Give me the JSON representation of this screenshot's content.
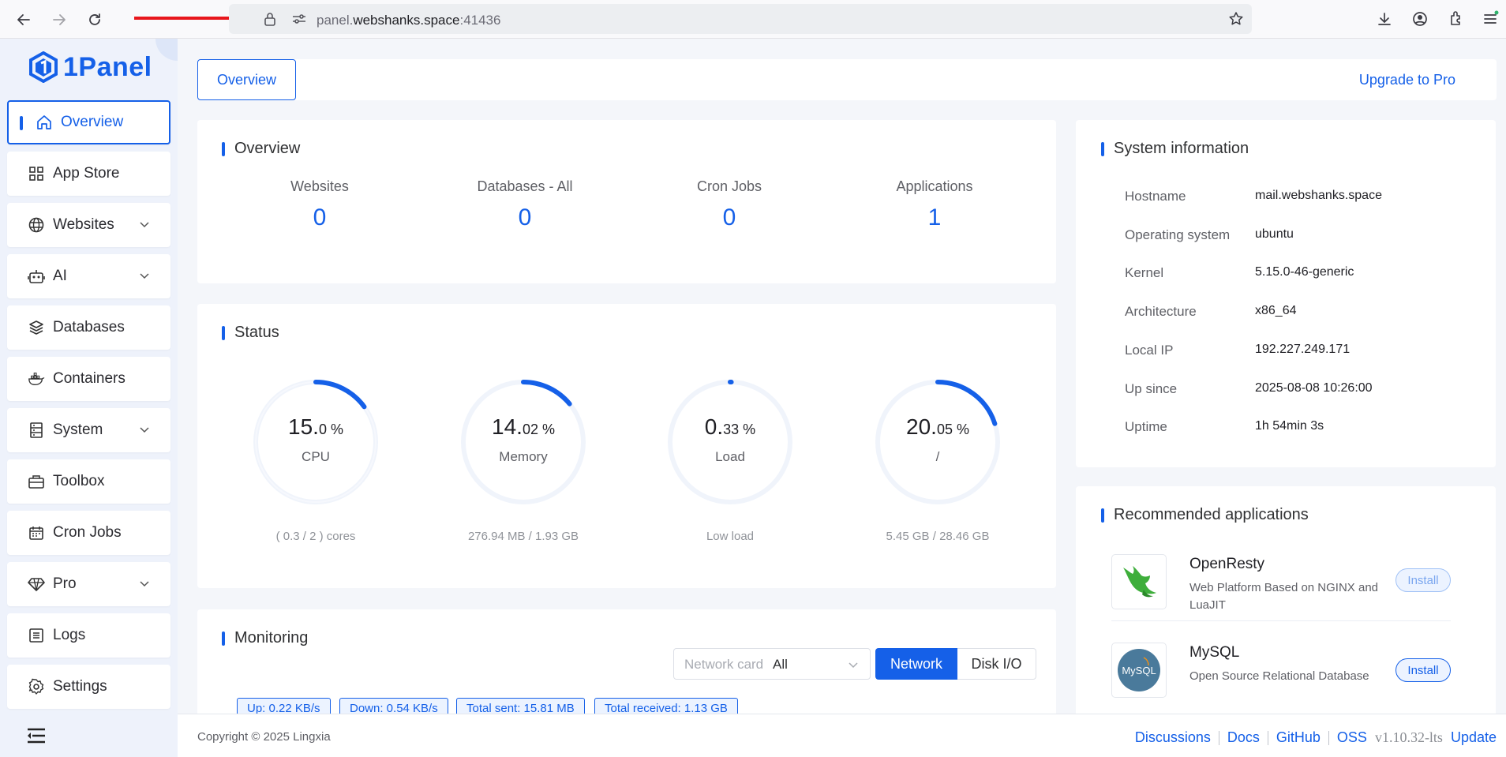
{
  "browser": {
    "url_prefix": "panel.",
    "url_domain": "webshanks.space",
    "url_suffix": ":41436"
  },
  "sidebar": {
    "logo_text": "1Panel",
    "items": [
      {
        "label": "Overview",
        "icon": "home-icon",
        "active": true
      },
      {
        "label": "App Store",
        "icon": "grid-icon"
      },
      {
        "label": "Websites",
        "icon": "globe-icon",
        "expandable": true
      },
      {
        "label": "AI",
        "icon": "robot-icon",
        "expandable": true
      },
      {
        "label": "Databases",
        "icon": "layers-icon"
      },
      {
        "label": "Containers",
        "icon": "docker-icon"
      },
      {
        "label": "System",
        "icon": "server-icon",
        "expandable": true
      },
      {
        "label": "Toolbox",
        "icon": "toolbox-icon"
      },
      {
        "label": "Cron Jobs",
        "icon": "calendar-icon"
      },
      {
        "label": "Pro",
        "icon": "diamond-icon",
        "expandable": true
      },
      {
        "label": "Logs",
        "icon": "list-icon"
      },
      {
        "label": "Settings",
        "icon": "gear-icon"
      }
    ]
  },
  "tabs": {
    "overview_label": "Overview",
    "upgrade_label": "Upgrade to Pro"
  },
  "overview": {
    "title": "Overview",
    "items": [
      {
        "label": "Websites",
        "value": "0"
      },
      {
        "label": "Databases - All",
        "value": "0"
      },
      {
        "label": "Cron Jobs",
        "value": "0"
      },
      {
        "label": "Applications",
        "value": "1"
      }
    ]
  },
  "status": {
    "title": "Status",
    "gauges": [
      {
        "big": "15.",
        "small": "0 %",
        "label": "CPU",
        "sub": "( 0.3 / 2 ) cores",
        "percent": 15.0
      },
      {
        "big": "14.",
        "small": "02 %",
        "label": "Memory",
        "sub": "276.94 MB / 1.93 GB",
        "percent": 14.02
      },
      {
        "big": "0.",
        "small": "33 %",
        "label": "Load",
        "sub": "Low load",
        "percent": 0.33
      },
      {
        "big": "20.",
        "small": "05 %",
        "label": "/",
        "sub": "5.45 GB / 28.46 GB",
        "percent": 20.05
      }
    ]
  },
  "monitoring": {
    "title": "Monitoring",
    "select_placeholder": "Network card",
    "select_value": "All",
    "btn_network": "Network",
    "btn_disk": "Disk I/O",
    "tags": [
      "Up: 0.22 KB/s",
      "Down: 0.54 KB/s",
      "Total sent: 15.81 MB",
      "Total received: 1.13 GB"
    ]
  },
  "system_info": {
    "title": "System information",
    "rows": [
      {
        "key": "Hostname",
        "value": "mail.webshanks.space"
      },
      {
        "key": "Operating system",
        "value": "ubuntu"
      },
      {
        "key": "Kernel",
        "value": "5.15.0-46-generic"
      },
      {
        "key": "Architecture",
        "value": "x86_64"
      },
      {
        "key": "Local IP",
        "value": "192.227.249.171"
      },
      {
        "key": "Up since",
        "value": "2025-08-08 10:26:00"
      },
      {
        "key": "Uptime",
        "value": "1h 54min 3s"
      }
    ]
  },
  "recommended": {
    "title": "Recommended applications",
    "apps": [
      {
        "name": "OpenResty",
        "desc": "Web Platform Based on NGINX and LuaJIT",
        "button": "Install",
        "logo_text": ""
      },
      {
        "name": "MySQL",
        "desc": "Open Source Relational Database",
        "button": "Install",
        "logo_text": "MySQL"
      }
    ]
  },
  "footer": {
    "copyright": "Copyright © 2025 Lingxia",
    "links": [
      "Discussions",
      "Docs",
      "GitHub",
      "OSS"
    ],
    "version": "v1.10.32-lts",
    "update": "Update"
  },
  "colors": {
    "accent": "#1560e8",
    "sidebar_bg": "#eef2fb",
    "page_bg": "#f4f6fa"
  }
}
